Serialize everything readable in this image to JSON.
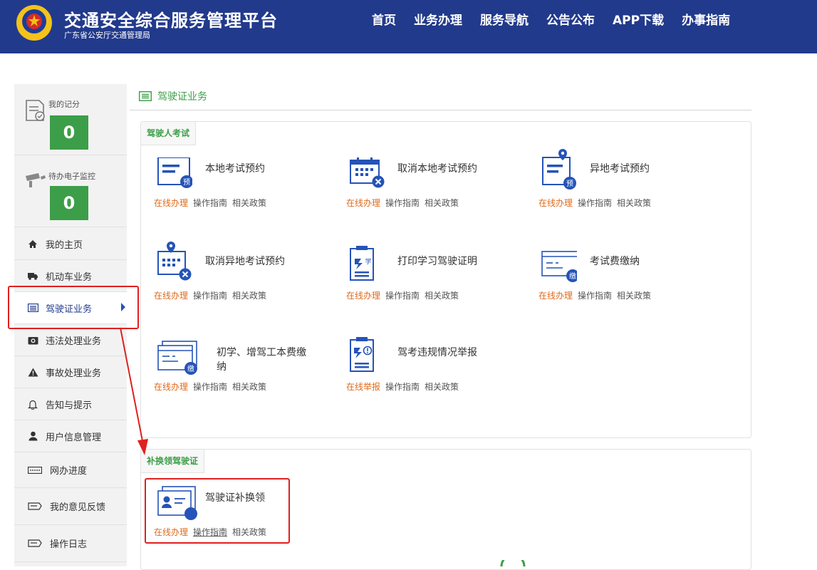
{
  "header": {
    "title": "交通安全综合服务管理平台",
    "subtitle": "广东省公安厅交通管理局",
    "nav": [
      "首页",
      "业务办理",
      "服务导航",
      "公告公布",
      "APP下载",
      "办事指南"
    ]
  },
  "sidebar": {
    "stats": [
      {
        "label": "我的记分",
        "value": "0"
      },
      {
        "label": "待办电子监控",
        "value": "0"
      }
    ],
    "items": [
      {
        "label": "我的主页",
        "icon": "home-icon"
      },
      {
        "label": "机动车业务",
        "icon": "truck-icon"
      },
      {
        "label": "驾驶证业务",
        "icon": "list-icon"
      },
      {
        "label": "违法处理业务",
        "icon": "camera-icon"
      },
      {
        "label": "事故处理业务",
        "icon": "warning-icon"
      },
      {
        "label": "告知与提示",
        "icon": "bell-icon"
      },
      {
        "label": "用户信息管理",
        "icon": "user-icon"
      },
      {
        "label": "网办进度",
        "icon": "progress-icon"
      },
      {
        "label": "我的意见反馈",
        "icon": "feedback-icon"
      },
      {
        "label": "操作日志",
        "icon": "log-icon"
      }
    ]
  },
  "main": {
    "section_title": "驾驶证业务",
    "groups": [
      {
        "tag": "驾驶人考试",
        "services": [
          {
            "title": "本地考试预约",
            "links": [
              "在线办理",
              "操作指南",
              "相关政策"
            ]
          },
          {
            "title": "取消本地考试预约",
            "links": [
              "在线办理",
              "操作指南",
              "相关政策"
            ]
          },
          {
            "title": "异地考试预约",
            "links": [
              "在线办理",
              "操作指南",
              "相关政策"
            ]
          },
          {
            "title": "取消异地考试预约",
            "links": [
              "在线办理",
              "操作指南",
              "相关政策"
            ]
          },
          {
            "title": "打印学习驾驶证明",
            "links": [
              "在线办理",
              "操作指南",
              "相关政策"
            ]
          },
          {
            "title": "考试费缴纳",
            "links": [
              "在线办理",
              "操作指南",
              "相关政策"
            ]
          },
          {
            "title": "初学、增驾工本费缴纳",
            "links": [
              "在线办理",
              "操作指南",
              "相关政策"
            ]
          },
          {
            "title": "驾考违规情况举报",
            "links": [
              "在线举报",
              "操作指南",
              "相关政策"
            ]
          }
        ]
      },
      {
        "tag": "补换领驾驶证",
        "services": [
          {
            "title": "驾驶证补换领",
            "links": [
              "在线办理",
              "操作指南",
              "相关政策"
            ]
          }
        ]
      }
    ]
  },
  "icon_glyphs": {
    "pre": "预",
    "fee": "缴",
    "study": "学"
  },
  "colors": {
    "header": "#223a8c",
    "green": "#3c9e48",
    "online_link": "#e06a1a",
    "highlight": "#e02020",
    "icon_blue": "#2553b8"
  }
}
